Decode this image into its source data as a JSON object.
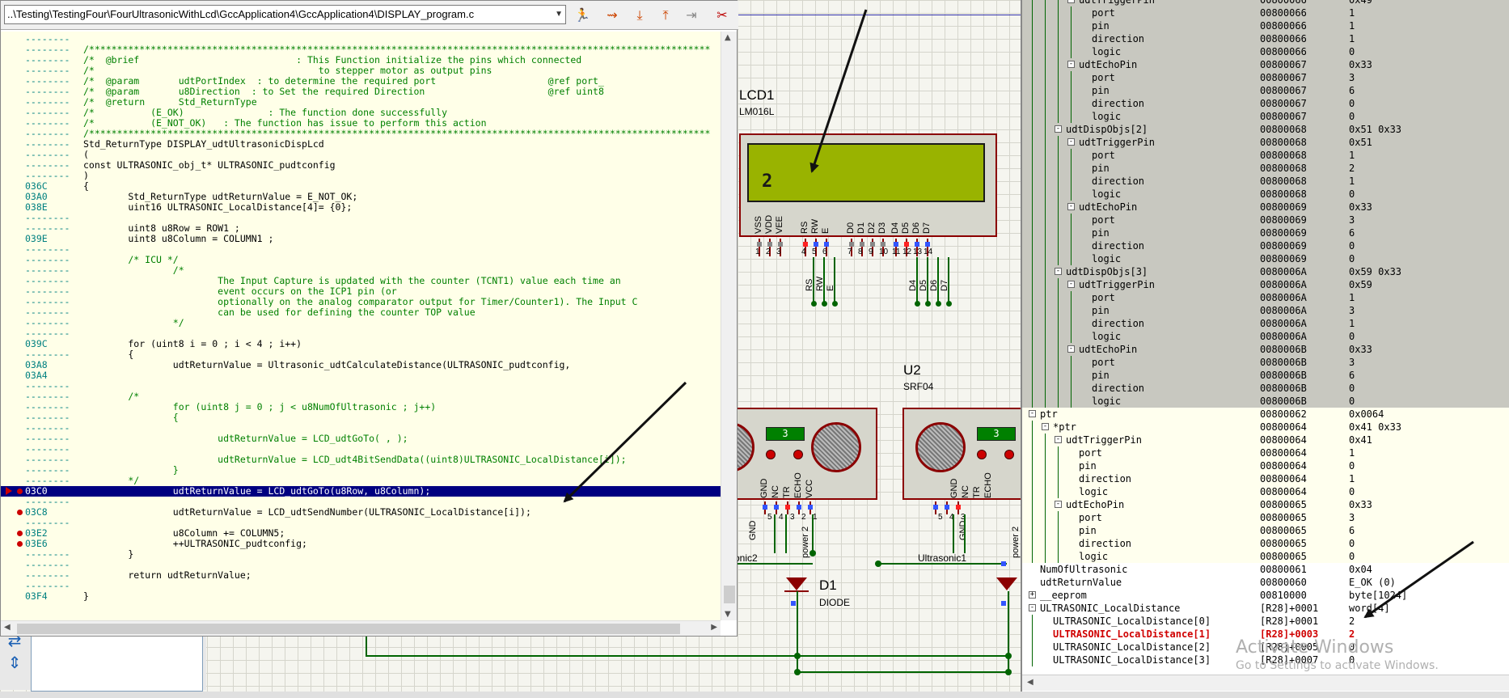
{
  "source": {
    "file_path": "..\\Testing\\TestingFour\\FourUltrasonicWithLcd\\GccApplication4\\GccApplication4\\DISPLAY_program.c",
    "lines": [
      {
        "addr": "--------",
        "code": ""
      },
      {
        "addr": "--------",
        "code": "/***************************************************************************************************************",
        "cls": "cm"
      },
      {
        "addr": "--------",
        "code": "/*  @brief                            : This Function initialize the pins which connected",
        "cls": "cm"
      },
      {
        "addr": "--------",
        "code": "/*                                        to stepper motor as output pins",
        "cls": "cm"
      },
      {
        "addr": "--------",
        "code": "/*  @param       udtPortIndex  : to determine the required port                    @ref port_",
        "cls": "cm"
      },
      {
        "addr": "--------",
        "code": "/*  @param       u8Direction  : to Set the required Direction                      @ref uint8",
        "cls": "cm"
      },
      {
        "addr": "--------",
        "code": "/*  @return      Std_ReturnType",
        "cls": "cm"
      },
      {
        "addr": "--------",
        "code": "/*          (E_OK)               : The function done successfully",
        "cls": "cm"
      },
      {
        "addr": "--------",
        "code": "/*          (E_NOT_OK)   : The function has issue to perform this action",
        "cls": "cm"
      },
      {
        "addr": "--------",
        "code": "/***************************************************************************************************************",
        "cls": "cm"
      },
      {
        "addr": "--------",
        "code": "Std_ReturnType DISPLAY_udtUltrasonicDispLcd"
      },
      {
        "addr": "--------",
        "code": "("
      },
      {
        "addr": "--------",
        "code": "const ULTRASONIC_obj_t* ULTRASONIC_pudtconfig"
      },
      {
        "addr": "--------",
        "code": ")"
      },
      {
        "addr": "036C",
        "code": "{"
      },
      {
        "addr": "03A0",
        "code": "        Std_ReturnType udtReturnValue = E_NOT_OK;"
      },
      {
        "addr": "038E",
        "code": "        uint16 ULTRASONIC_LocalDistance[4]= {0};"
      },
      {
        "addr": "--------",
        "code": ""
      },
      {
        "addr": "--------",
        "code": "        uint8 u8Row = ROW1 ;"
      },
      {
        "addr": "039E",
        "code": "        uint8 u8Column = COLUMN1 ;"
      },
      {
        "addr": "--------",
        "code": ""
      },
      {
        "addr": "--------",
        "code": "        /* ICU */",
        "cls": "cm"
      },
      {
        "addr": "--------",
        "code": "                /*",
        "cls": "cm"
      },
      {
        "addr": "--------",
        "code": "                        The Input Capture is updated with the counter (TCNT1) value each time an",
        "cls": "cm"
      },
      {
        "addr": "--------",
        "code": "                        event occurs on the ICP1 pin (or",
        "cls": "cm"
      },
      {
        "addr": "--------",
        "code": "                        optionally on the analog comparator output for Timer/Counter1). The Input C",
        "cls": "cm"
      },
      {
        "addr": "--------",
        "code": "                        can be used for defining the counter TOP value",
        "cls": "cm"
      },
      {
        "addr": "--------",
        "code": "                */",
        "cls": "cm"
      },
      {
        "addr": "--------",
        "code": ""
      },
      {
        "addr": "039C",
        "code": "        for (uint8 i = 0 ; i < 4 ; i++)"
      },
      {
        "addr": "--------",
        "code": "        {"
      },
      {
        "addr": "03A8",
        "code": "                udtReturnValue = Ultrasonic_udtCalculateDistance(ULTRASONIC_pudtconfig,"
      },
      {
        "addr": "03A4",
        "code": ""
      },
      {
        "addr": "--------",
        "code": ""
      },
      {
        "addr": "--------",
        "code": "        /*",
        "cls": "cm"
      },
      {
        "addr": "--------",
        "code": "                for (uint8 j = 0 ; j < u8NumOfUltrasonic ; j++)",
        "cls": "cm"
      },
      {
        "addr": "--------",
        "code": "                {",
        "cls": "cm"
      },
      {
        "addr": "--------",
        "code": "",
        "cls": "cm"
      },
      {
        "addr": "--------",
        "code": "                        udtReturnValue = LCD_udtGoTo( , );",
        "cls": "cm"
      },
      {
        "addr": "--------",
        "code": "",
        "cls": "cm"
      },
      {
        "addr": "--------",
        "code": "                        udtReturnValue = LCD_udt4BitSendData((uint8)ULTRASONIC_LocalDistance[i]);",
        "cls": "cm"
      },
      {
        "addr": "--------",
        "code": "                }",
        "cls": "cm"
      },
      {
        "addr": "--------",
        "code": "        */",
        "cls": "cm"
      },
      {
        "addr": "03C0",
        "code": "                udtReturnValue = LCD_udtGoTo(u8Row, u8Column);",
        "current": true,
        "bp": true
      },
      {
        "addr": "--------",
        "code": ""
      },
      {
        "addr": "03C8",
        "code": "                udtReturnValue = LCD_udtSendNumber(ULTRASONIC_LocalDistance[i]);",
        "bp": true
      },
      {
        "addr": "--------",
        "code": ""
      },
      {
        "addr": "03E2",
        "code": "                u8Column += COLUMN5;",
        "bp": true
      },
      {
        "addr": "03E6",
        "code": "                ++ULTRASONIC_pudtconfig;",
        "bp": true
      },
      {
        "addr": "--------",
        "code": "        }"
      },
      {
        "addr": "--------",
        "code": ""
      },
      {
        "addr": "--------",
        "code": "        return udtReturnValue;"
      },
      {
        "addr": "--------",
        "code": ""
      },
      {
        "addr": "03F4",
        "code": "}"
      }
    ]
  },
  "schematic": {
    "lcd_ref": "LCD1",
    "lcd_model": "LM016L",
    "lcd_display_text": "2",
    "lcd_pins": [
      "VSS",
      "VDD",
      "VEE",
      "RS",
      "RW",
      "E",
      "D0",
      "D1",
      "D2",
      "D3",
      "D4",
      "D5",
      "D6",
      "D7"
    ],
    "lcd_pin_numbers": [
      "1",
      "2",
      "3",
      "4",
      "5",
      "6",
      "7",
      "8",
      "9",
      "10",
      "11",
      "12",
      "13",
      "14"
    ],
    "lcd_bus_labels_left": [
      "RS",
      "RW",
      "E"
    ],
    "lcd_bus_labels_right": [
      "D4",
      "D5",
      "D6",
      "D7"
    ],
    "u2_ref": "U2",
    "u2_model": "SRF04",
    "sensor_display_left": "3",
    "sensor_display_right": "3",
    "sensor_pins_left": [
      "GND",
      "NC",
      "TR",
      "ECHO",
      "VCC"
    ],
    "sensor_pins_right": [
      "GND",
      "NC",
      "TR",
      "ECHO"
    ],
    "sensor_gnd_label": "GND",
    "sensor_power_label": "power 2",
    "sensor_pin_numbers_left": [
      "5",
      "4",
      "3",
      "2",
      "1"
    ],
    "sensor_pin_numbers_right": [
      "5",
      "4",
      "3"
    ],
    "net_label_left": "onic2",
    "net_label_right": "Ultrasonic1",
    "diode_ref": "D1",
    "diode_model": "DIODE"
  },
  "watch": {
    "rows": [
      {
        "name": "udtTriggerPin",
        "addr": "00800066",
        "val": "0x49",
        "indent": 3,
        "box": "-",
        "style": "alt"
      },
      {
        "name": "port",
        "addr": "00800066",
        "val": "1",
        "indent": 4,
        "style": "alt"
      },
      {
        "name": "pin",
        "addr": "00800066",
        "val": "1",
        "indent": 4,
        "style": "alt"
      },
      {
        "name": "direction",
        "addr": "00800066",
        "val": "1",
        "indent": 4,
        "style": "alt"
      },
      {
        "name": "logic",
        "addr": "00800066",
        "val": "0",
        "indent": 4,
        "style": "alt"
      },
      {
        "name": "udtEchoPin",
        "addr": "00800067",
        "val": "0x33",
        "indent": 3,
        "box": "-",
        "style": "alt"
      },
      {
        "name": "port",
        "addr": "00800067",
        "val": "3",
        "indent": 4,
        "style": "alt"
      },
      {
        "name": "pin",
        "addr": "00800067",
        "val": "6",
        "indent": 4,
        "style": "alt"
      },
      {
        "name": "direction",
        "addr": "00800067",
        "val": "0",
        "indent": 4,
        "style": "alt"
      },
      {
        "name": "logic",
        "addr": "00800067",
        "val": "0",
        "indent": 4,
        "style": "alt"
      },
      {
        "name": "udtDispObjs[2]",
        "addr": "00800068",
        "val": "0x51 0x33",
        "indent": 2,
        "box": "-",
        "style": "alt"
      },
      {
        "name": "udtTriggerPin",
        "addr": "00800068",
        "val": "0x51",
        "indent": 3,
        "box": "-",
        "style": "alt"
      },
      {
        "name": "port",
        "addr": "00800068",
        "val": "1",
        "indent": 4,
        "style": "alt"
      },
      {
        "name": "pin",
        "addr": "00800068",
        "val": "2",
        "indent": 4,
        "style": "alt"
      },
      {
        "name": "direction",
        "addr": "00800068",
        "val": "1",
        "indent": 4,
        "style": "alt"
      },
      {
        "name": "logic",
        "addr": "00800068",
        "val": "0",
        "indent": 4,
        "style": "alt"
      },
      {
        "name": "udtEchoPin",
        "addr": "00800069",
        "val": "0x33",
        "indent": 3,
        "box": "-",
        "style": "alt"
      },
      {
        "name": "port",
        "addr": "00800069",
        "val": "3",
        "indent": 4,
        "style": "alt"
      },
      {
        "name": "pin",
        "addr": "00800069",
        "val": "6",
        "indent": 4,
        "style": "alt"
      },
      {
        "name": "direction",
        "addr": "00800069",
        "val": "0",
        "indent": 4,
        "style": "alt"
      },
      {
        "name": "logic",
        "addr": "00800069",
        "val": "0",
        "indent": 4,
        "style": "alt"
      },
      {
        "name": "udtDispObjs[3]",
        "addr": "0080006A",
        "val": "0x59 0x33",
        "indent": 2,
        "box": "-",
        "style": "alt"
      },
      {
        "name": "udtTriggerPin",
        "addr": "0080006A",
        "val": "0x59",
        "indent": 3,
        "box": "-",
        "style": "alt"
      },
      {
        "name": "port",
        "addr": "0080006A",
        "val": "1",
        "indent": 4,
        "style": "alt"
      },
      {
        "name": "pin",
        "addr": "0080006A",
        "val": "3",
        "indent": 4,
        "style": "alt"
      },
      {
        "name": "direction",
        "addr": "0080006A",
        "val": "1",
        "indent": 4,
        "style": "alt"
      },
      {
        "name": "logic",
        "addr": "0080006A",
        "val": "0",
        "indent": 4,
        "style": "alt"
      },
      {
        "name": "udtEchoPin",
        "addr": "0080006B",
        "val": "0x33",
        "indent": 3,
        "box": "-",
        "style": "alt"
      },
      {
        "name": "port",
        "addr": "0080006B",
        "val": "3",
        "indent": 4,
        "style": "alt"
      },
      {
        "name": "pin",
        "addr": "0080006B",
        "val": "6",
        "indent": 4,
        "style": "alt"
      },
      {
        "name": "direction",
        "addr": "0080006B",
        "val": "0",
        "indent": 4,
        "style": "alt"
      },
      {
        "name": "logic",
        "addr": "0080006B",
        "val": "0",
        "indent": 4,
        "style": "alt"
      },
      {
        "name": "ptr",
        "addr": "00800062",
        "val": "0x0064",
        "indent": 0,
        "box": "-",
        "style": "lit"
      },
      {
        "name": "*ptr",
        "addr": "00800064",
        "val": "0x41 0x33",
        "indent": 1,
        "box": "-",
        "style": "lit"
      },
      {
        "name": "udtTriggerPin",
        "addr": "00800064",
        "val": "0x41",
        "indent": 2,
        "box": "-",
        "style": "lit"
      },
      {
        "name": "port",
        "addr": "00800064",
        "val": "1",
        "indent": 3,
        "style": "lit"
      },
      {
        "name": "pin",
        "addr": "00800064",
        "val": "0",
        "indent": 3,
        "style": "lit"
      },
      {
        "name": "direction",
        "addr": "00800064",
        "val": "1",
        "indent": 3,
        "style": "lit"
      },
      {
        "name": "logic",
        "addr": "00800064",
        "val": "0",
        "indent": 3,
        "style": "lit"
      },
      {
        "name": "udtEchoPin",
        "addr": "00800065",
        "val": "0x33",
        "indent": 2,
        "box": "-",
        "style": "lit"
      },
      {
        "name": "port",
        "addr": "00800065",
        "val": "3",
        "indent": 3,
        "style": "lit"
      },
      {
        "name": "pin",
        "addr": "00800065",
        "val": "6",
        "indent": 3,
        "style": "lit"
      },
      {
        "name": "direction",
        "addr": "00800065",
        "val": "0",
        "indent": 3,
        "style": "lit"
      },
      {
        "name": "logic",
        "addr": "00800065",
        "val": "0",
        "indent": 3,
        "style": "lit"
      },
      {
        "name": "NumOfUltrasonic",
        "addr": "00800061",
        "val": "0x04",
        "indent": 0,
        "style": "plain"
      },
      {
        "name": "udtReturnValue",
        "addr": "00800060",
        "val": "E_OK (0)",
        "indent": 0,
        "style": "plain"
      },
      {
        "name": "__eeprom",
        "addr": "00810000",
        "val": "byte[1024]",
        "indent": 0,
        "box": "+",
        "style": "plain"
      },
      {
        "name": "ULTRASONIC_LocalDistance",
        "addr": "[R28]+0001",
        "val": "word[4]",
        "indent": 0,
        "box": "-",
        "style": "plain"
      },
      {
        "name": "ULTRASONIC_LocalDistance[0]",
        "addr": "[R28]+0001",
        "val": "2",
        "indent": 1,
        "style": "plain"
      },
      {
        "name": "ULTRASONIC_LocalDistance[1]",
        "addr": "[R28]+0003",
        "val": "2",
        "indent": 1,
        "style": "plain",
        "changed": true
      },
      {
        "name": "ULTRASONIC_LocalDistance[2]",
        "addr": "[R28]+0005",
        "val": "0",
        "indent": 1,
        "style": "plain"
      },
      {
        "name": "ULTRASONIC_LocalDistance[3]",
        "addr": "[R28]+0007",
        "val": "0",
        "indent": 1,
        "style": "plain"
      }
    ],
    "watermark_title": "Activate Windows",
    "watermark_sub": "Go to Settings to activate Windows."
  },
  "icons": {
    "toolbar": [
      "run-icon",
      "step-over-icon",
      "step-into-icon",
      "step-out-icon",
      "run-to-cursor-icon",
      "breakpoint-toggle-icon"
    ]
  },
  "colors": {
    "code_bg": "#ffffe8",
    "current_line": "#000080",
    "comment": "#008000",
    "keyword": "#0000c0",
    "watch_alt": "#c8c8c0",
    "changed": "#d00000",
    "lcd_screen": "#99b300",
    "component_border": "#8b0000",
    "wire": "#006400"
  }
}
